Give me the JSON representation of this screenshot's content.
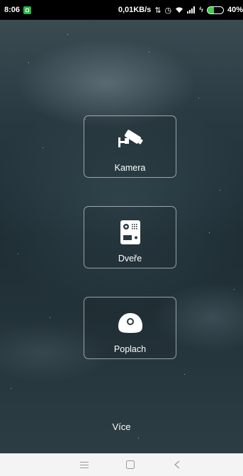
{
  "status_bar": {
    "time": "8:06",
    "network_speed": "0,01KB/s",
    "battery_percent": "40%",
    "battery_level": 0.4,
    "battery_color": "#3ad34a",
    "app_notification_color": "#2db84a"
  },
  "tiles": [
    {
      "label": "Kamera",
      "icon": "security-camera-icon"
    },
    {
      "label": "Dveře",
      "icon": "door-intercom-icon"
    },
    {
      "label": "Poplach",
      "icon": "alarm-sensor-icon"
    }
  ],
  "more_label": "Více",
  "nav_bar": {
    "menu_icon": "menu-icon",
    "home_icon": "home-icon",
    "back_icon": "back-icon"
  }
}
